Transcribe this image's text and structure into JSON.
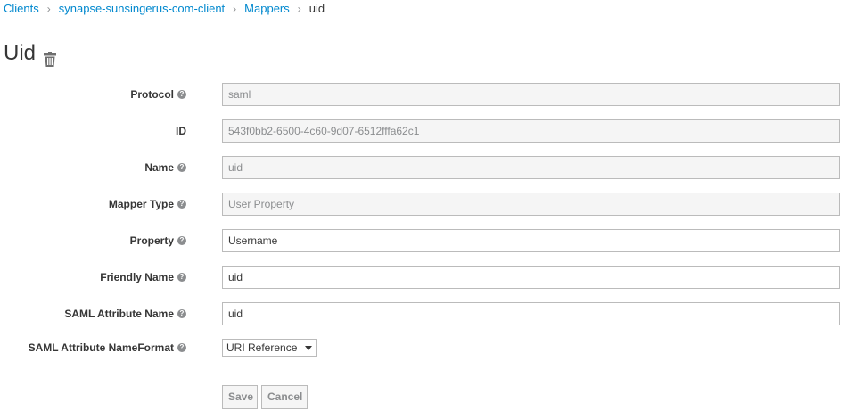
{
  "breadcrumb": {
    "items": [
      {
        "label": "Clients"
      },
      {
        "label": "synapse-sunsingerus-com-client"
      },
      {
        "label": "Mappers"
      }
    ],
    "current": "uid",
    "separator": "›"
  },
  "page": {
    "title": "Uid"
  },
  "form": {
    "protocol": {
      "label": "Protocol",
      "value": "saml"
    },
    "id": {
      "label": "ID",
      "value": "543f0bb2-6500-4c60-9d07-6512fffa62c1"
    },
    "name": {
      "label": "Name",
      "value": "uid"
    },
    "mapper_type": {
      "label": "Mapper Type",
      "value": "User Property"
    },
    "property": {
      "label": "Property",
      "value": "Username"
    },
    "friendly_name": {
      "label": "Friendly Name",
      "value": "uid"
    },
    "saml_attribute_name": {
      "label": "SAML Attribute Name",
      "value": "uid"
    },
    "saml_attribute_nameformat": {
      "label": "SAML Attribute NameFormat",
      "value": "URI Reference"
    }
  },
  "buttons": {
    "save_label": "Save",
    "cancel_label": "Cancel"
  },
  "help_icon_glyph": "?",
  "colors": {
    "link": "#0088ce",
    "text": "#363636",
    "muted": "#8b8d8f",
    "readonly_bg": "#f5f5f5",
    "border": "#bbbbbb"
  }
}
